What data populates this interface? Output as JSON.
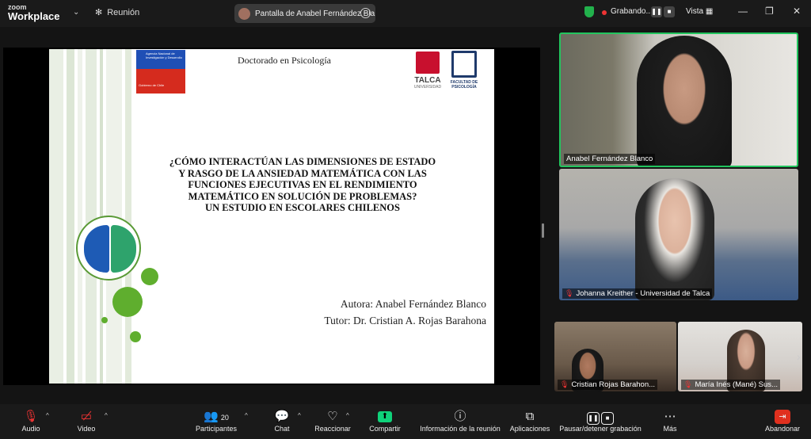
{
  "app": {
    "logo_line1": "zoom",
    "logo_line2": "Workplace",
    "meeting_label": "Reunión",
    "share_label": "Pantalla de Anabel Fernández Bla",
    "share_more": "...",
    "recording_label": "Grabando...",
    "view_label": "Vista"
  },
  "slide": {
    "header": "Doctorado en Psicología",
    "title_lines": [
      "¿CÓMO INTERACTÚAN LAS DIMENSIONES DE ESTADO",
      "Y RASGO DE LA ANSIEDAD MATEMÁTICA CON LAS",
      "FUNCIONES EJECUTIVAS EN EL RENDIMIENTO",
      "MATEMÁTICO EN SOLUCIÓN DE PROBLEMAS?",
      "UN ESTUDIO EN ESCOLARES CHILENOS"
    ],
    "author": "Autora: Anabel Fernández Blanco",
    "tutor": "Tutor: Dr. Cristian A. Rojas Barahona",
    "anid_text": "Agencia Nacional de Investigación y Desarrollo",
    "anid_sub": "Gobierno de Chile",
    "talca_logo": "TALCA",
    "talca_sub": "UNIVERSIDAD",
    "psico_logo": "FACULTAD DE PSICOLOGÍA"
  },
  "participants": {
    "p1": "Anabel Fernández Blanco",
    "p2": "Johanna Kreither - Universidad de Talca",
    "p3": "Cristian Rojas Barahon...",
    "p4": "María Inés (Mané) Sus..."
  },
  "toolbar": {
    "audio": "Audio",
    "video": "Video",
    "participants": "Participantes",
    "participants_count": "20",
    "chat": "Chat",
    "react": "Reaccionar",
    "share": "Compartir",
    "info": "Información de la reunión",
    "apps": "Aplicaciones",
    "record": "Pausar/detener grabación",
    "more": "Más",
    "leave": "Abandonar"
  },
  "colors": {
    "active_speaker": "#22c55e",
    "share_green": "#0fd27a",
    "leave_red": "#e0301e"
  }
}
